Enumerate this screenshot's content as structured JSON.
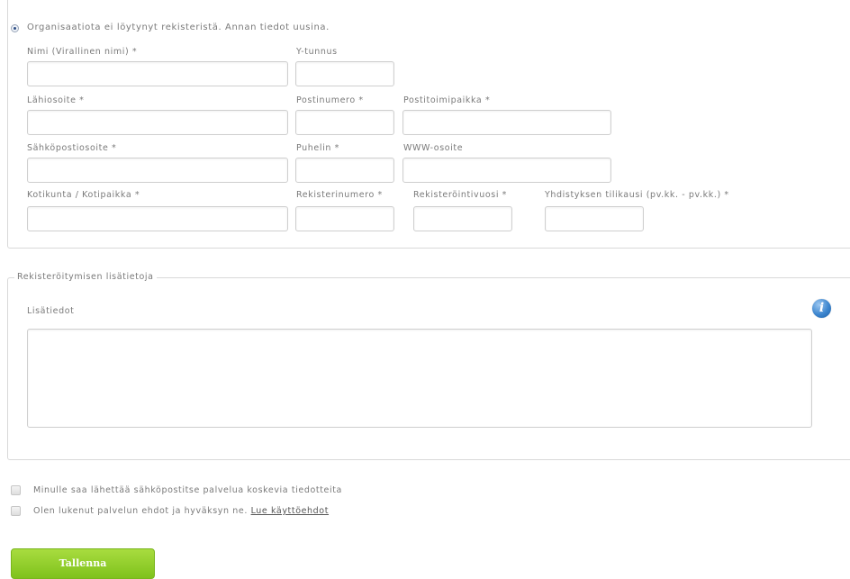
{
  "organization": {
    "radio_label": "Organisaatiota ei löytynyt rekisteristä. Annan tiedot uusina.",
    "fields": {
      "name": {
        "label": "Nimi (Virallinen nimi) *",
        "value": ""
      },
      "business_id": {
        "label": "Y-tunnus",
        "value": ""
      },
      "street_address": {
        "label": "Lähiosoite *",
        "value": ""
      },
      "postal_code": {
        "label": "Postinumero *",
        "value": ""
      },
      "city": {
        "label": "Postitoimipaikka *",
        "value": ""
      },
      "email": {
        "label": "Sähköpostiosoite *",
        "value": ""
      },
      "phone": {
        "label": "Puhelin *",
        "value": ""
      },
      "website": {
        "label": "WWW-osoite",
        "value": ""
      },
      "municipality": {
        "label": "Kotikunta / Kotipaikka *",
        "value": ""
      },
      "register_number": {
        "label": "Rekisterinumero *",
        "value": ""
      },
      "register_year": {
        "label": "Rekisteröintivuosi *",
        "value": ""
      },
      "fiscal_period": {
        "label": "Yhdistyksen tilikausi (pv.kk. - pv.kk.) *",
        "value": ""
      }
    }
  },
  "additional": {
    "legend": "Rekisteröitymisen lisätietoja",
    "label": "Lisätiedot",
    "value": ""
  },
  "options": {
    "newsletter_label": "Minulle saa lähettää sähköpostitse palvelua koskevia tiedotteita",
    "terms_label": "Olen lukenut palvelun ehdot ja hyväksyn ne.",
    "terms_link": "Lue käyttöehdot"
  },
  "save_label": "Tallenna"
}
